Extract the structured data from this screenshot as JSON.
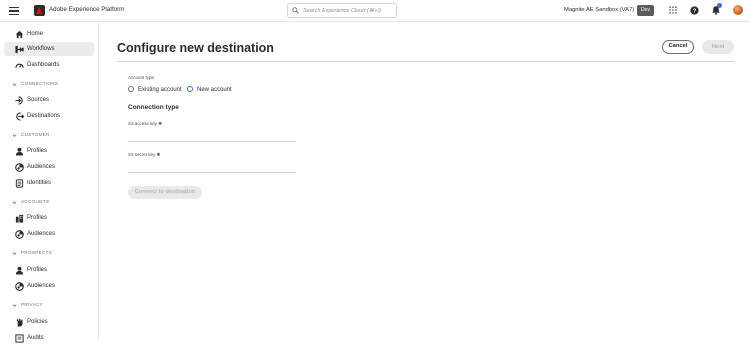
{
  "app": {
    "title": "Adobe Experience Platform",
    "search_placeholder": "Search Experience Cloud (⌘+/)",
    "sandbox_label": "Magnite AE Sandbox (VA7)",
    "env_badge": "Dev"
  },
  "sidebar": {
    "items": [
      {
        "label": "Home",
        "icon": "home-icon"
      },
      {
        "label": "Workflows",
        "icon": "workflows-icon",
        "active": true
      },
      {
        "label": "Dashboards",
        "icon": "dashboards-icon"
      }
    ],
    "sections": [
      {
        "title": "CONNECTIONS",
        "items": [
          {
            "label": "Sources",
            "icon": "sources-icon"
          },
          {
            "label": "Destinations",
            "icon": "destinations-icon"
          }
        ]
      },
      {
        "title": "CUSTOMER",
        "items": [
          {
            "label": "Profiles",
            "icon": "profile-icon"
          },
          {
            "label": "Audiences",
            "icon": "audiences-icon"
          },
          {
            "label": "Identities",
            "icon": "identities-icon"
          }
        ]
      },
      {
        "title": "ACCOUNTS",
        "items": [
          {
            "label": "Profiles",
            "icon": "account-profiles-icon"
          },
          {
            "label": "Audiences",
            "icon": "audiences-icon"
          }
        ]
      },
      {
        "title": "PROSPECTS",
        "items": [
          {
            "label": "Profiles",
            "icon": "profile-icon"
          },
          {
            "label": "Audiences",
            "icon": "audiences-icon"
          }
        ]
      },
      {
        "title": "PRIVACY",
        "items": [
          {
            "label": "Policies",
            "icon": "policies-icon"
          },
          {
            "label": "Audits",
            "icon": "audits-icon"
          }
        ]
      }
    ]
  },
  "main": {
    "title": "Configure new destination",
    "cancel_label": "Cancel",
    "next_label": "Next",
    "account_type_label": "Account type",
    "account_options": [
      {
        "label": "Existing account",
        "checked": false
      },
      {
        "label": "New account",
        "checked": true
      }
    ],
    "connection_type_title": "Connection type",
    "s3_access_key_label": "S3 access key",
    "s3_secret_key_label": "S3 secret key",
    "required_marker": "✱",
    "connect_label": "Connect to destination"
  }
}
